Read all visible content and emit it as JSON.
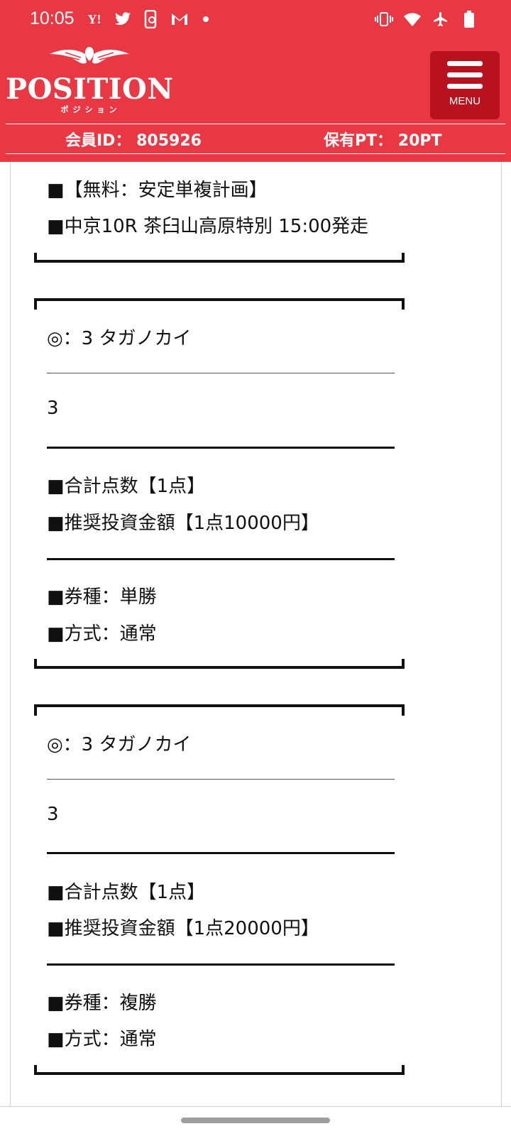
{
  "status_bar": {
    "time": "10:05",
    "left_icons": [
      "yahoo-icon",
      "twitter-icon",
      "phone-sync-icon",
      "gmail-icon",
      "dot-icon"
    ],
    "right_icons": [
      "vibrate-icon",
      "wifi-icon",
      "airplane-icon",
      "battery-icon"
    ],
    "yahoo_label": "Y!"
  },
  "header": {
    "logo_text": "POSITION",
    "logo_sub": "ポジション",
    "menu_label": "MENU",
    "member_id": "会員ID： 805926",
    "points": "保有PT： 20PT",
    "brand_color": "#e93744",
    "menu_color": "#b8121f"
  },
  "content": {
    "intro": {
      "line1": "■【無料：安定単複計画】",
      "line2": "■中京10R 茶臼山高原特別 15:00発走"
    },
    "block1": {
      "pick": "◎：3 タガノカイ",
      "number": "3",
      "total": "■合計点数【1点】",
      "amount": "■推奨投資金額【1点10000円】",
      "ticket": "■券種：単勝",
      "method": "■方式：通常"
    },
    "block2": {
      "pick": "◎：3 タガノカイ",
      "number": "3",
      "total": "■合計点数【1点】",
      "amount": "■推奨投資金額【1点20000円】",
      "ticket": "■券種：複勝",
      "method": "■方式：通常"
    }
  }
}
